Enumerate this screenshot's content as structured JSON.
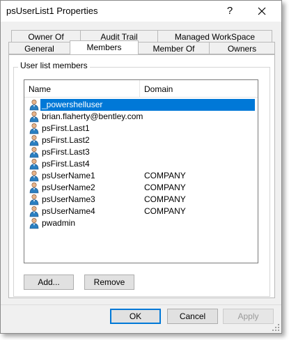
{
  "window": {
    "title": "psUserList1 Properties",
    "help_glyph": "?",
    "close_glyph": "✕"
  },
  "tabs": {
    "row1": [
      "Owner Of",
      "Audit Trail",
      "Managed WorkSpace"
    ],
    "row2": [
      "General",
      "Members",
      "Member Of",
      "Owners"
    ],
    "active": "Members"
  },
  "members": {
    "group_label": "User list members",
    "columns": {
      "name": "Name",
      "domain": "Domain"
    },
    "rows": [
      {
        "name": "_powershelluser",
        "domain": "",
        "selected": true
      },
      {
        "name": "brian.flaherty@bentley.com",
        "domain": ""
      },
      {
        "name": "psFirst.Last1",
        "domain": ""
      },
      {
        "name": "psFirst.Last2",
        "domain": ""
      },
      {
        "name": "psFirst.Last3",
        "domain": ""
      },
      {
        "name": "psFirst.Last4",
        "domain": ""
      },
      {
        "name": "psUserName1",
        "domain": "COMPANY"
      },
      {
        "name": "psUserName2",
        "domain": "COMPANY"
      },
      {
        "name": "psUserName3",
        "domain": "COMPANY"
      },
      {
        "name": "psUserName4",
        "domain": "COMPANY"
      },
      {
        "name": "pwadmin",
        "domain": ""
      }
    ],
    "add_label": "Add...",
    "remove_label": "Remove"
  },
  "footer": {
    "ok_label": "OK",
    "cancel_label": "Cancel",
    "apply_label": "Apply"
  },
  "icons": {
    "user": "user-icon",
    "close": "close-icon",
    "help": "help-icon"
  },
  "colors": {
    "selection": "#0078d7",
    "window_bg": "#f0f0f0"
  }
}
